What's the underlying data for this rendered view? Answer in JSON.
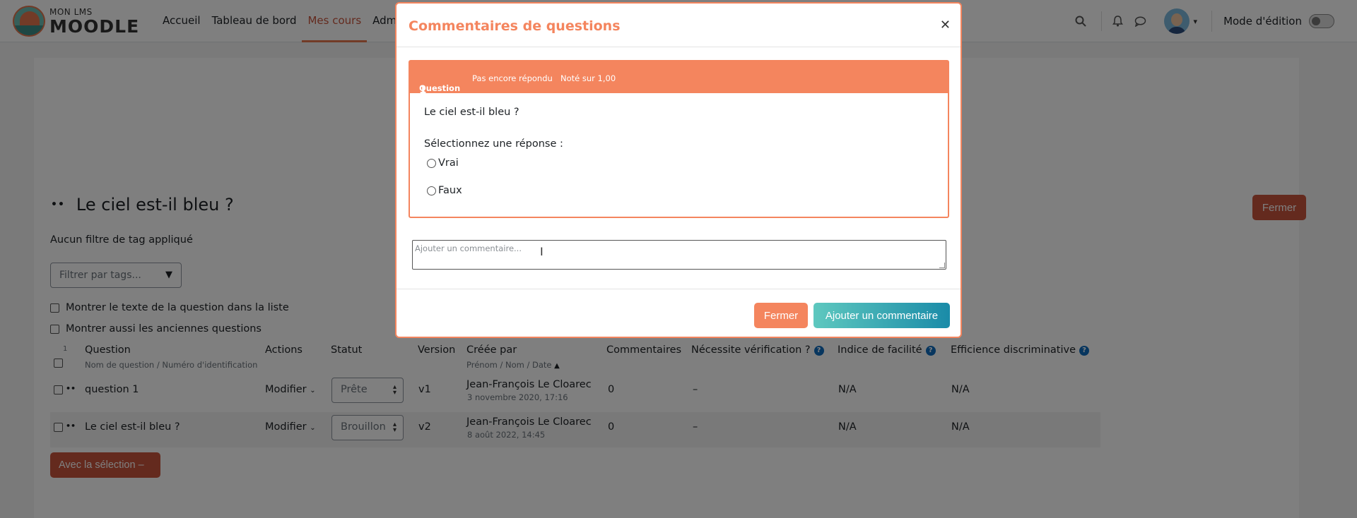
{
  "navbar": {
    "brand_small": "MON LMS",
    "brand_big": "MOODLE",
    "links": [
      "Accueil",
      "Tableau de bord",
      "Mes cours",
      "Adminis"
    ],
    "edit_mode_label": "Mode d'édition"
  },
  "page": {
    "title": "Le ciel est-il bleu ?",
    "close_label": "Fermer",
    "no_tag_filter": "Aucun filtre de tag appliqué",
    "tag_filter_placeholder": "Filtrer par tags...",
    "show_question_text": "Montrer le texte de la question dans la liste",
    "show_old_questions": "Montrer aussi les anciennes questions",
    "bulk_label": "Avec la sélection –"
  },
  "table": {
    "select_all_count": "1",
    "headers": {
      "question": "Question",
      "question_sub": "Nom de question / Numéro d'identification",
      "actions": "Actions",
      "status": "Statut",
      "version": "Version",
      "created_by": "Créée par",
      "created_by_sub": "Prénom / Nom / Date",
      "comments": "Commentaires",
      "needs_check": "Nécessite vérification ?",
      "facility": "Indice de facilité",
      "discrimination": "Efficience discriminative"
    },
    "rows": [
      {
        "name": "question 1",
        "action": "Modifier",
        "status": "Prête",
        "version": "v1",
        "author": "Jean-François Le Cloarec",
        "date": "3 novembre 2020, 17:16",
        "comments": "0",
        "needs_check": "–",
        "facility": "N/A",
        "discrimination": "N/A"
      },
      {
        "name": "Le ciel est-il bleu ?",
        "action": "Modifier",
        "status": "Brouillon",
        "version": "v2",
        "author": "Jean-François Le Cloarec",
        "date": "8 août 2022, 14:45",
        "comments": "0",
        "needs_check": "–",
        "facility": "N/A",
        "discrimination": "N/A"
      }
    ]
  },
  "modal": {
    "title": "Commentaires de questions",
    "question_label": "Question",
    "question_number": "1",
    "state": "Pas encore répondu",
    "grade": "Noté sur 1,00",
    "question_text": "Le ciel est-il bleu ?",
    "select_prompt": "Sélectionnez une réponse :",
    "options": [
      "Vrai",
      "Faux"
    ],
    "comment_placeholder": "Ajouter un commentaire...",
    "close_label": "Fermer",
    "add_label": "Ajouter un commentaire"
  },
  "colors": {
    "accent": "#f4855e",
    "brand_red": "#c8553d",
    "teal_start": "#5ec8bf",
    "teal_end": "#1a8ba8"
  }
}
